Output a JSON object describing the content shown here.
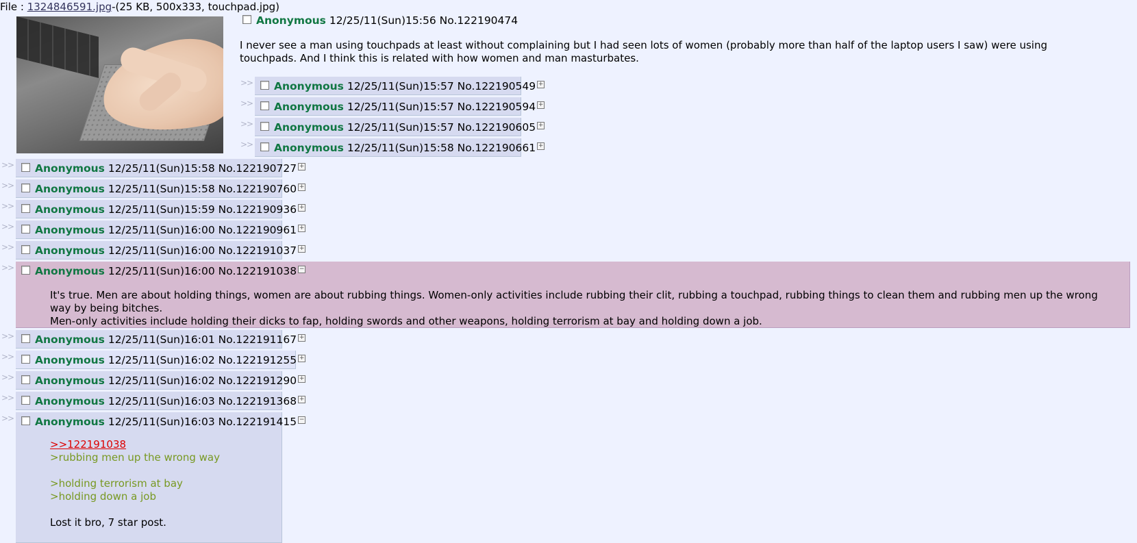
{
  "file": {
    "prefix": "File : ",
    "filename": "1324846591.jpg",
    "meta": "-(25 KB, 500x333, touchpad.jpg)"
  },
  "op": {
    "name": "Anonymous",
    "datetime": "12/25/11(Sun)15:56",
    "number": "No.122190474",
    "text": "I never see a man using touchpads at least without complaining but I had seen lots of women (probably more than half of the laptop users I saw) were using touchpads. And I think this is related with how women and man masturbates."
  },
  "arrow": ">>",
  "expand_icon": "plus-box-icon",
  "collapse_icon": "minus-box-icon",
  "replies": [
    {
      "name": "Anonymous",
      "datetime": "12/25/11(Sun)15:57",
      "number": "No.122190549"
    },
    {
      "name": "Anonymous",
      "datetime": "12/25/11(Sun)15:57",
      "number": "No.122190594"
    },
    {
      "name": "Anonymous",
      "datetime": "12/25/11(Sun)15:57",
      "number": "No.122190605"
    },
    {
      "name": "Anonymous",
      "datetime": "12/25/11(Sun)15:58",
      "number": "No.122190661"
    },
    {
      "name": "Anonymous",
      "datetime": "12/25/11(Sun)15:58",
      "number": "No.122190727"
    },
    {
      "name": "Anonymous",
      "datetime": "12/25/11(Sun)15:58",
      "number": "No.122190760"
    },
    {
      "name": "Anonymous",
      "datetime": "12/25/11(Sun)15:59",
      "number": "No.122190936"
    },
    {
      "name": "Anonymous",
      "datetime": "12/25/11(Sun)16:00",
      "number": "No.122190961"
    },
    {
      "name": "Anonymous",
      "datetime": "12/25/11(Sun)16:00",
      "number": "No.122191037"
    },
    {
      "name": "Anonymous",
      "datetime": "12/25/11(Sun)16:00",
      "number": "No.122191038",
      "lines": [
        "It's true. Men are about holding things, women are about rubbing things. Women-only activities include rubbing their clit, rubbing a touchpad, rubbing things to clean them and rubbing men up the wrong way by being bitches.",
        "Men-only activities include holding their dicks to fap, holding swords and other weapons, holding terrorism at bay and holding down a job."
      ]
    },
    {
      "name": "Anonymous",
      "datetime": "12/25/11(Sun)16:01",
      "number": "No.122191167"
    },
    {
      "name": "Anonymous",
      "datetime": "12/25/11(Sun)16:02",
      "number": "No.122191255"
    },
    {
      "name": "Anonymous",
      "datetime": "12/25/11(Sun)16:02",
      "number": "No.122191290"
    },
    {
      "name": "Anonymous",
      "datetime": "12/25/11(Sun)16:03",
      "number": "No.122191368"
    },
    {
      "name": "Anonymous",
      "datetime": "12/25/11(Sun)16:03",
      "number": "No.122191415",
      "quote_link": ">>122191038",
      "greentext": [
        ">rubbing men up the wrong way",
        ">holding terrorism at bay",
        ">holding down a job"
      ],
      "closing": "Lost it bro, 7 star post."
    }
  ],
  "colors": {
    "background": "#eef2ff",
    "reply_bg": "#d6daf0",
    "highlight_bg": "#d6bad0",
    "name": "#117743",
    "greentext": "#789922",
    "quotelink": "#dd0000"
  }
}
